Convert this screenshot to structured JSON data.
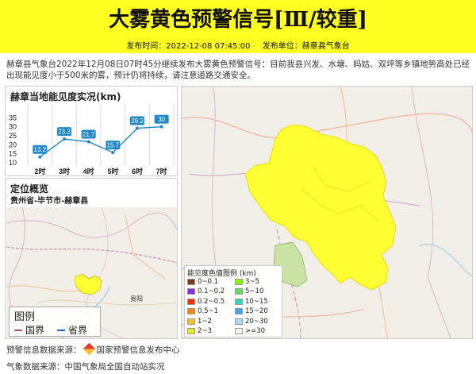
{
  "header": {
    "title": "大雾黄色预警信号[Ⅲ/较重]",
    "publish_time_label": "发布时间：2022-12-08 07:45:00",
    "publisher_label": "发布单位：赫章县气象台"
  },
  "description": "赫章县气象台2022年12月08日07时45分继续发布大雾黄色预警信号：目前我县兴发、水塘、妈姑、双坪等乡镇地势高处已经出现能见度小于500米的雾，预计仍将持续，请注意道路交通安全。",
  "chart_panel": {
    "title": "赫章当地能见度实况(km)"
  },
  "chart_data": {
    "type": "line",
    "title": "赫章当地能见度实况(km)",
    "categories": [
      "2时",
      "3时",
      "4时",
      "5时",
      "6时",
      "7时"
    ],
    "values": [
      13.2,
      23.2,
      21.7,
      15.7,
      29.2,
      30
    ],
    "value_labels": [
      "13.2",
      "23.2",
      "21.7",
      "15.7",
      "29.2",
      "30"
    ],
    "y_ticks": [
      "35",
      "30",
      "25",
      "20",
      "15",
      "10"
    ],
    "ylim": [
      10,
      40
    ],
    "line_color": "#1e88c8",
    "grid": true
  },
  "location_panel": {
    "title": "定位概览",
    "path": "贵州省-毕节市-赫章县",
    "city_label": "贵阳",
    "legend": {
      "title": "图例",
      "country_label": "国界",
      "province_label": "省界"
    }
  },
  "visibility_legend": {
    "title": "能见度色值图例 (km)",
    "items": [
      {
        "label": "0~0.1",
        "color": "#7b3f1d"
      },
      {
        "label": "3~5",
        "color": "#7cfc00"
      },
      {
        "label": "0.1~0.2",
        "color": "#8a2be2"
      },
      {
        "label": "5~10",
        "color": "#5ee05e"
      },
      {
        "label": "0.2~0.5",
        "color": "#ff2a00"
      },
      {
        "label": "10~15",
        "color": "#33d6c2"
      },
      {
        "label": "0.5~1",
        "color": "#ff8c00"
      },
      {
        "label": "15~20",
        "color": "#3fa7f0"
      },
      {
        "label": "1~2",
        "color": "#f2c12e"
      },
      {
        "label": "20~30",
        "color": "#a9d8f5"
      },
      {
        "label": "2~3",
        "color": "#e8e820"
      },
      {
        "label": ">=30",
        "color": "#f4f4f4"
      }
    ]
  },
  "footer": {
    "warning_source": "预警信息数据来源：",
    "warning_source_org": "国家预警信息发布中心",
    "weather_source": "气象数据来源：中国气象局全国自动站实况"
  }
}
